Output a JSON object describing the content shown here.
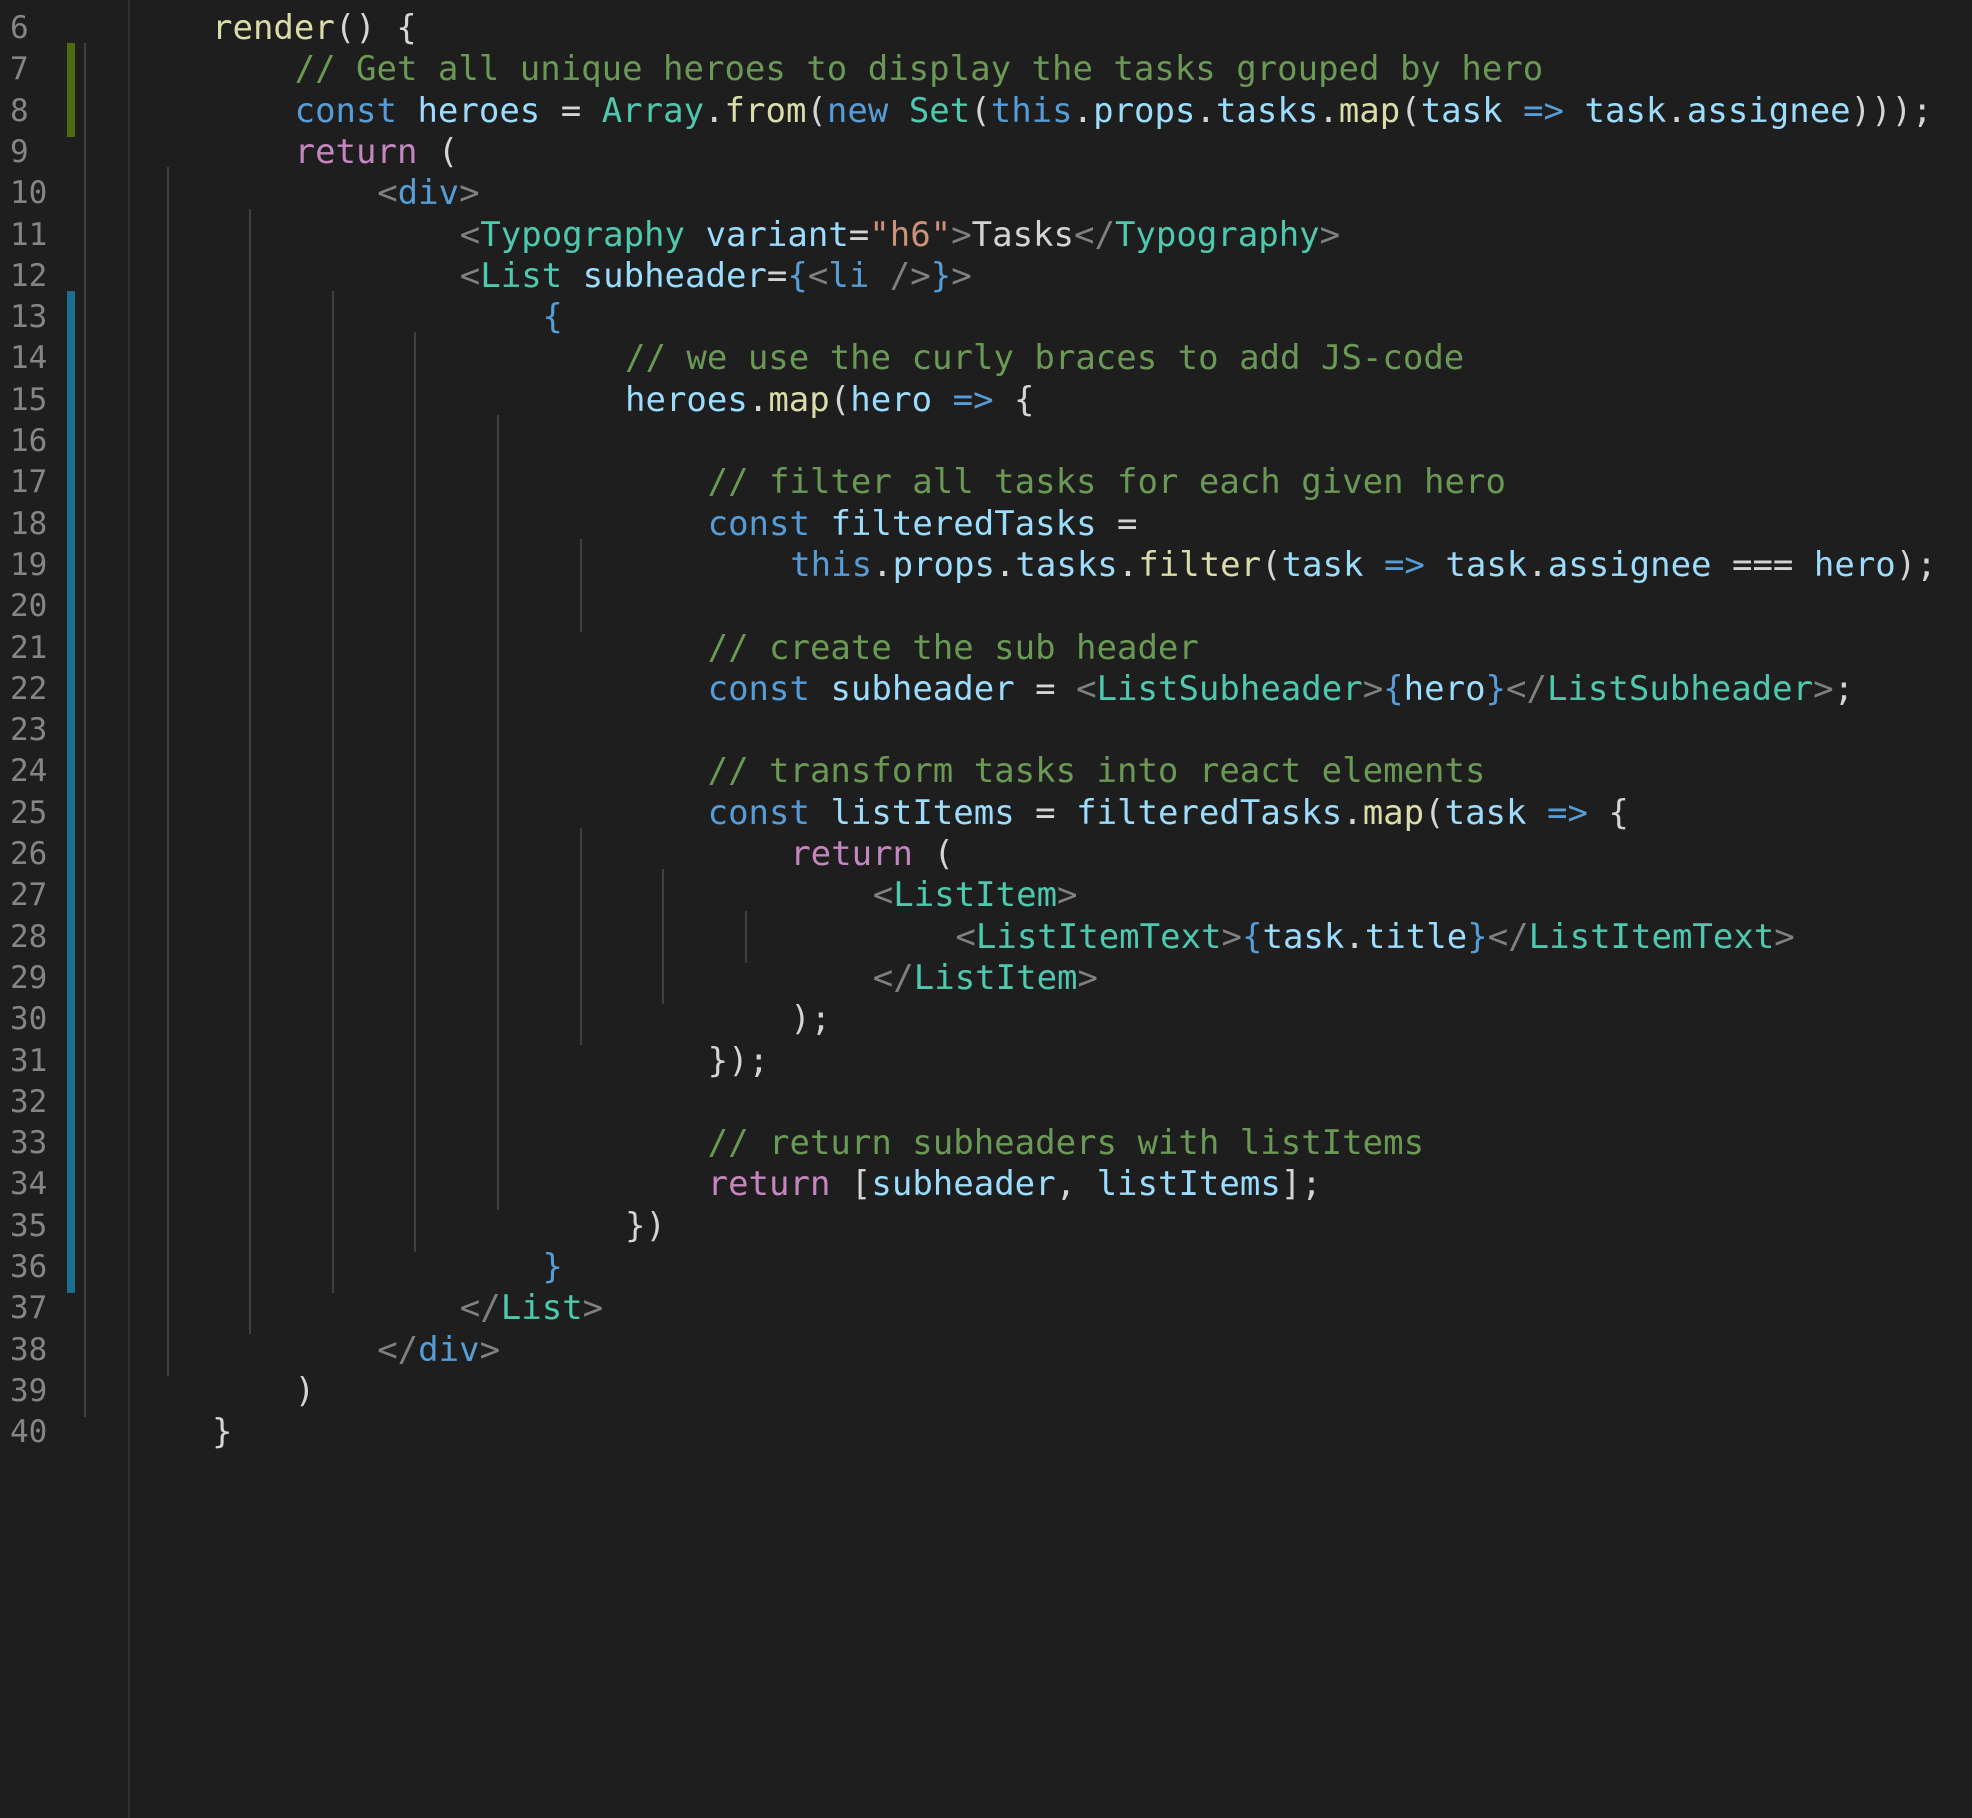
{
  "editor": {
    "colors": {
      "background": "#1e1e1e",
      "line_number": "#858585",
      "diff_modified": "#4d6b0f",
      "diff_added": "#1b6e8f",
      "indent_guide": "#404040",
      "keyword": "#569cd6",
      "control": "#c586c0",
      "function": "#dcdcaa",
      "variable": "#9cdcfe",
      "type": "#4ec9b0",
      "tag_bracket": "#808080",
      "string": "#ce9178",
      "comment": "#6a9955",
      "plain": "#d4d4d4"
    },
    "lines": [
      {
        "number": "6",
        "diff": "none",
        "indent": 1,
        "guides": 1,
        "tokens": [
          [
            "function",
            "render"
          ],
          [
            "plain",
            "() {"
          ]
        ]
      },
      {
        "number": "7",
        "diff": "modified",
        "indent": 2,
        "guides": 2,
        "tokens": [
          [
            "comment",
            "// Get all unique heroes to display the tasks grouped by hero"
          ]
        ]
      },
      {
        "number": "8",
        "diff": "modified",
        "indent": 2,
        "guides": 2,
        "tokens": [
          [
            "keyword",
            "const"
          ],
          [
            "plain",
            " "
          ],
          [
            "variable",
            "heroes"
          ],
          [
            "plain",
            " = "
          ],
          [
            "type",
            "Array"
          ],
          [
            "plain",
            "."
          ],
          [
            "function",
            "from"
          ],
          [
            "plain",
            "("
          ],
          [
            "keyword",
            "new"
          ],
          [
            "plain",
            " "
          ],
          [
            "type",
            "Set"
          ],
          [
            "plain",
            "("
          ],
          [
            "keyword",
            "this"
          ],
          [
            "plain",
            "."
          ],
          [
            "variable",
            "props"
          ],
          [
            "plain",
            "."
          ],
          [
            "variable",
            "tasks"
          ],
          [
            "plain",
            "."
          ],
          [
            "function",
            "map"
          ],
          [
            "plain",
            "("
          ],
          [
            "variable",
            "task"
          ],
          [
            "plain",
            " "
          ],
          [
            "keyword",
            "=>"
          ],
          [
            "plain",
            " "
          ],
          [
            "variable",
            "task"
          ],
          [
            "plain",
            "."
          ],
          [
            "variable",
            "assignee"
          ],
          [
            "plain",
            ")));"
          ]
        ]
      },
      {
        "number": "9",
        "diff": "none",
        "indent": 2,
        "guides": 2,
        "tokens": [
          [
            "control",
            "return"
          ],
          [
            "plain",
            " ("
          ]
        ]
      },
      {
        "number": "10",
        "diff": "none",
        "indent": 3,
        "guides": 3,
        "tokens": [
          [
            "tag-bracket",
            "<"
          ],
          [
            "keyword",
            "div"
          ],
          [
            "tag-bracket",
            ">"
          ]
        ]
      },
      {
        "number": "11",
        "diff": "none",
        "indent": 4,
        "guides": 4,
        "tokens": [
          [
            "tag-bracket",
            "<"
          ],
          [
            "type",
            "Typography"
          ],
          [
            "plain",
            " "
          ],
          [
            "variable",
            "variant"
          ],
          [
            "plain",
            "="
          ],
          [
            "string",
            "\"h6\""
          ],
          [
            "tag-bracket",
            ">"
          ],
          [
            "plain",
            "Tasks"
          ],
          [
            "tag-bracket",
            "</"
          ],
          [
            "type",
            "Typography"
          ],
          [
            "tag-bracket",
            ">"
          ]
        ]
      },
      {
        "number": "12",
        "diff": "none",
        "indent": 4,
        "guides": 4,
        "tokens": [
          [
            "tag-bracket",
            "<"
          ],
          [
            "type",
            "List"
          ],
          [
            "plain",
            " "
          ],
          [
            "variable",
            "subheader"
          ],
          [
            "plain",
            "="
          ],
          [
            "brace",
            "{"
          ],
          [
            "tag-bracket",
            "<"
          ],
          [
            "keyword",
            "li"
          ],
          [
            "plain",
            " "
          ],
          [
            "tag-bracket",
            "/>"
          ],
          [
            "brace",
            "}"
          ],
          [
            "tag-bracket",
            ">"
          ]
        ]
      },
      {
        "number": "13",
        "diff": "added",
        "indent": 5,
        "guides": 5,
        "tokens": [
          [
            "brace",
            "{"
          ]
        ]
      },
      {
        "number": "14",
        "diff": "added",
        "indent": 6,
        "guides": 6,
        "tokens": [
          [
            "comment",
            "// we use the curly braces to add JS-code"
          ]
        ]
      },
      {
        "number": "15",
        "diff": "added",
        "indent": 6,
        "guides": 6,
        "tokens": [
          [
            "variable",
            "heroes"
          ],
          [
            "plain",
            "."
          ],
          [
            "function",
            "map"
          ],
          [
            "plain",
            "("
          ],
          [
            "variable",
            "hero"
          ],
          [
            "plain",
            " "
          ],
          [
            "keyword",
            "=>"
          ],
          [
            "plain",
            " {"
          ]
        ]
      },
      {
        "number": "16",
        "diff": "added",
        "indent": 0,
        "guides": 7,
        "tokens": []
      },
      {
        "number": "17",
        "diff": "added",
        "indent": 7,
        "guides": 7,
        "tokens": [
          [
            "comment",
            "// filter all tasks for each given hero"
          ]
        ]
      },
      {
        "number": "18",
        "diff": "added",
        "indent": 7,
        "guides": 7,
        "tokens": [
          [
            "keyword",
            "const"
          ],
          [
            "plain",
            " "
          ],
          [
            "variable",
            "filteredTasks"
          ],
          [
            "plain",
            " ="
          ]
        ]
      },
      {
        "number": "19",
        "diff": "added",
        "indent": 8,
        "guides": 8,
        "tokens": [
          [
            "keyword",
            "this"
          ],
          [
            "plain",
            "."
          ],
          [
            "variable",
            "props"
          ],
          [
            "plain",
            "."
          ],
          [
            "variable",
            "tasks"
          ],
          [
            "plain",
            "."
          ],
          [
            "function",
            "filter"
          ],
          [
            "plain",
            "("
          ],
          [
            "variable",
            "task"
          ],
          [
            "plain",
            " "
          ],
          [
            "keyword",
            "=>"
          ],
          [
            "plain",
            " "
          ],
          [
            "variable",
            "task"
          ],
          [
            "plain",
            "."
          ],
          [
            "variable",
            "assignee"
          ],
          [
            "plain",
            " === "
          ],
          [
            "variable",
            "hero"
          ],
          [
            "plain",
            ");"
          ]
        ]
      },
      {
        "number": "20",
        "diff": "added",
        "indent": 0,
        "guides": 8,
        "tokens": []
      },
      {
        "number": "21",
        "diff": "added",
        "indent": 7,
        "guides": 7,
        "tokens": [
          [
            "comment",
            "// create the sub header"
          ]
        ]
      },
      {
        "number": "22",
        "diff": "added",
        "indent": 7,
        "guides": 7,
        "tokens": [
          [
            "keyword",
            "const"
          ],
          [
            "plain",
            " "
          ],
          [
            "variable",
            "subheader"
          ],
          [
            "plain",
            " = "
          ],
          [
            "tag-bracket",
            "<"
          ],
          [
            "type",
            "ListSubheader"
          ],
          [
            "tag-bracket",
            ">"
          ],
          [
            "brace",
            "{"
          ],
          [
            "variable",
            "hero"
          ],
          [
            "brace",
            "}"
          ],
          [
            "tag-bracket",
            "</"
          ],
          [
            "type",
            "ListSubheader"
          ],
          [
            "tag-bracket",
            ">"
          ],
          [
            "plain",
            ";"
          ]
        ]
      },
      {
        "number": "23",
        "diff": "added",
        "indent": 0,
        "guides": 7,
        "tokens": []
      },
      {
        "number": "24",
        "diff": "added",
        "indent": 7,
        "guides": 7,
        "tokens": [
          [
            "comment",
            "// transform tasks into react elements"
          ]
        ]
      },
      {
        "number": "25",
        "diff": "added",
        "indent": 7,
        "guides": 7,
        "tokens": [
          [
            "keyword",
            "const"
          ],
          [
            "plain",
            " "
          ],
          [
            "variable",
            "listItems"
          ],
          [
            "plain",
            " = "
          ],
          [
            "variable",
            "filteredTasks"
          ],
          [
            "plain",
            "."
          ],
          [
            "function",
            "map"
          ],
          [
            "plain",
            "("
          ],
          [
            "variable",
            "task"
          ],
          [
            "plain",
            " "
          ],
          [
            "keyword",
            "=>"
          ],
          [
            "plain",
            " {"
          ]
        ]
      },
      {
        "number": "26",
        "diff": "added",
        "indent": 8,
        "guides": 8,
        "tokens": [
          [
            "control",
            "return"
          ],
          [
            "plain",
            " ("
          ]
        ]
      },
      {
        "number": "27",
        "diff": "added",
        "indent": 9,
        "guides": 9,
        "tokens": [
          [
            "tag-bracket",
            "<"
          ],
          [
            "type",
            "ListItem"
          ],
          [
            "tag-bracket",
            ">"
          ]
        ]
      },
      {
        "number": "28",
        "diff": "added",
        "indent": 10,
        "guides": 10,
        "tokens": [
          [
            "tag-bracket",
            "<"
          ],
          [
            "type",
            "ListItemText"
          ],
          [
            "tag-bracket",
            ">"
          ],
          [
            "brace",
            "{"
          ],
          [
            "variable",
            "task"
          ],
          [
            "plain",
            "."
          ],
          [
            "variable",
            "title"
          ],
          [
            "brace",
            "}"
          ],
          [
            "tag-bracket",
            "</"
          ],
          [
            "type",
            "ListItemText"
          ],
          [
            "tag-bracket",
            ">"
          ]
        ]
      },
      {
        "number": "29",
        "diff": "added",
        "indent": 9,
        "guides": 9,
        "tokens": [
          [
            "tag-bracket",
            "</"
          ],
          [
            "type",
            "ListItem"
          ],
          [
            "tag-bracket",
            ">"
          ]
        ]
      },
      {
        "number": "30",
        "diff": "added",
        "indent": 8,
        "guides": 8,
        "tokens": [
          [
            "plain",
            ");"
          ]
        ]
      },
      {
        "number": "31",
        "diff": "added",
        "indent": 7,
        "guides": 7,
        "tokens": [
          [
            "plain",
            "});"
          ]
        ]
      },
      {
        "number": "32",
        "diff": "added",
        "indent": 0,
        "guides": 7,
        "tokens": []
      },
      {
        "number": "33",
        "diff": "added",
        "indent": 7,
        "guides": 7,
        "tokens": [
          [
            "comment",
            "// return subheaders with listItems"
          ]
        ]
      },
      {
        "number": "34",
        "diff": "added",
        "indent": 7,
        "guides": 7,
        "tokens": [
          [
            "control",
            "return"
          ],
          [
            "plain",
            " ["
          ],
          [
            "variable",
            "subheader"
          ],
          [
            "plain",
            ", "
          ],
          [
            "variable",
            "listItems"
          ],
          [
            "plain",
            "];"
          ]
        ]
      },
      {
        "number": "35",
        "diff": "added",
        "indent": 6,
        "guides": 6,
        "tokens": [
          [
            "plain",
            "})"
          ]
        ]
      },
      {
        "number": "36",
        "diff": "added",
        "indent": 5,
        "guides": 5,
        "tokens": [
          [
            "brace",
            "}"
          ]
        ]
      },
      {
        "number": "37",
        "diff": "none",
        "indent": 4,
        "guides": 4,
        "tokens": [
          [
            "tag-bracket",
            "</"
          ],
          [
            "type",
            "List"
          ],
          [
            "tag-bracket",
            ">"
          ]
        ]
      },
      {
        "number": "38",
        "diff": "none",
        "indent": 3,
        "guides": 3,
        "tokens": [
          [
            "tag-bracket",
            "</"
          ],
          [
            "keyword",
            "div"
          ],
          [
            "tag-bracket",
            ">"
          ]
        ]
      },
      {
        "number": "39",
        "diff": "none",
        "indent": 2,
        "guides": 2,
        "tokens": [
          [
            "plain",
            ")"
          ]
        ]
      },
      {
        "number": "40",
        "diff": "none",
        "indent": 1,
        "guides": 1,
        "tokens": [
          [
            "plain",
            "}"
          ]
        ]
      }
    ]
  }
}
